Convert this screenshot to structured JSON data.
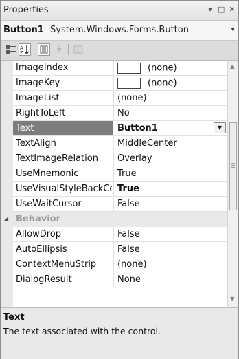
{
  "panel": {
    "title": "Properties",
    "controls": [
      "▾",
      "□",
      "✕"
    ]
  },
  "selector": {
    "name": "Button1",
    "type": "System.Windows.Forms.Button",
    "arrow": "▾"
  },
  "toolbar": {
    "buttons": [
      "categorized-icon",
      "alphabetical-icon",
      "properties-icon",
      "events-icon",
      "property-pages-icon"
    ]
  },
  "rows": [
    {
      "name": "ImageIndex",
      "value": "(none)",
      "swatch": true
    },
    {
      "name": "ImageKey",
      "value": "(none)",
      "swatch": true
    },
    {
      "name": "ImageList",
      "value": "(none)"
    },
    {
      "name": "RightToLeft",
      "value": "No"
    },
    {
      "name": "Text",
      "value": "Button1",
      "selected": true
    },
    {
      "name": "TextAlign",
      "value": "MiddleCenter"
    },
    {
      "name": "TextImageRelation",
      "value": "Overlay"
    },
    {
      "name": "UseMnemonic",
      "value": "True"
    },
    {
      "name": "UseVisualStyleBackCo",
      "value": "True",
      "bold": true
    },
    {
      "name": "UseWaitCursor",
      "value": "False"
    }
  ],
  "category": {
    "name": "Behavior",
    "expander": "◢"
  },
  "rows2": [
    {
      "name": "AllowDrop",
      "value": "False"
    },
    {
      "name": "AutoEllipsis",
      "value": "False"
    },
    {
      "name": "ContextMenuStrip",
      "value": "(none)"
    },
    {
      "name": "DialogResult",
      "value": "None"
    }
  ],
  "description": {
    "title": "Text",
    "text": "The text associated with the control."
  }
}
